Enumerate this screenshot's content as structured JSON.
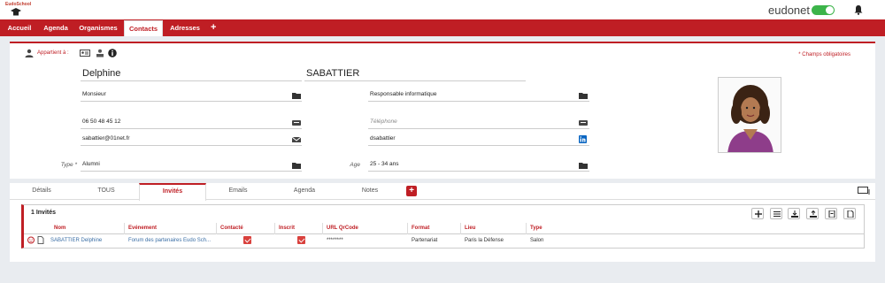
{
  "app": {
    "logo_text": "EudoSchool",
    "brand": "eudonet",
    "brand_mark": "✕"
  },
  "nav": {
    "items": [
      {
        "label": "Accueil"
      },
      {
        "label": "Agenda"
      },
      {
        "label": "Organismes"
      },
      {
        "label": "Contacts",
        "active": true
      },
      {
        "label": "Adresses"
      }
    ],
    "plus": "+"
  },
  "contact": {
    "owner_label": "Appartient à :",
    "required_note": "* Champs obligatoires",
    "first_name": "Delphine",
    "last_name": "SABATTIER",
    "civility": "Monsieur",
    "job_title": "Responsable informatique",
    "mobile": "06 50 48 45 12",
    "phone_placeholder": "Téléphone",
    "email": "sabattier@01net.fr",
    "linkedin": "dsabattier",
    "type_label": "Type *",
    "type_value": "Alumni",
    "age_label": "Age",
    "age_value": "25 - 34 ans"
  },
  "tabs": {
    "items": [
      {
        "label": "Détails"
      },
      {
        "label": "TOUS"
      },
      {
        "label": "Invités",
        "active": true
      },
      {
        "label": "Emails"
      },
      {
        "label": "Agenda"
      },
      {
        "label": "Notes"
      }
    ],
    "plus": "+"
  },
  "invites": {
    "title": "1 Invités",
    "columns": [
      "Nom",
      "Evénement",
      "Contacté",
      "Inscrit",
      "URL QrCode",
      "Format",
      "Lieu",
      "Type"
    ],
    "rows": [
      {
        "nom": "SABATTIER Delphine",
        "evenement": "Forum des partenaires Eudo Sch...",
        "contacte": true,
        "inscrit": true,
        "url_qrcode": "********",
        "format": "Partenariat",
        "lieu": "Paris la Défense",
        "type": "Salon"
      }
    ]
  },
  "colors": {
    "accent": "#bf1e24",
    "toggle": "#3cb44a",
    "link": "#3a6ea5"
  }
}
